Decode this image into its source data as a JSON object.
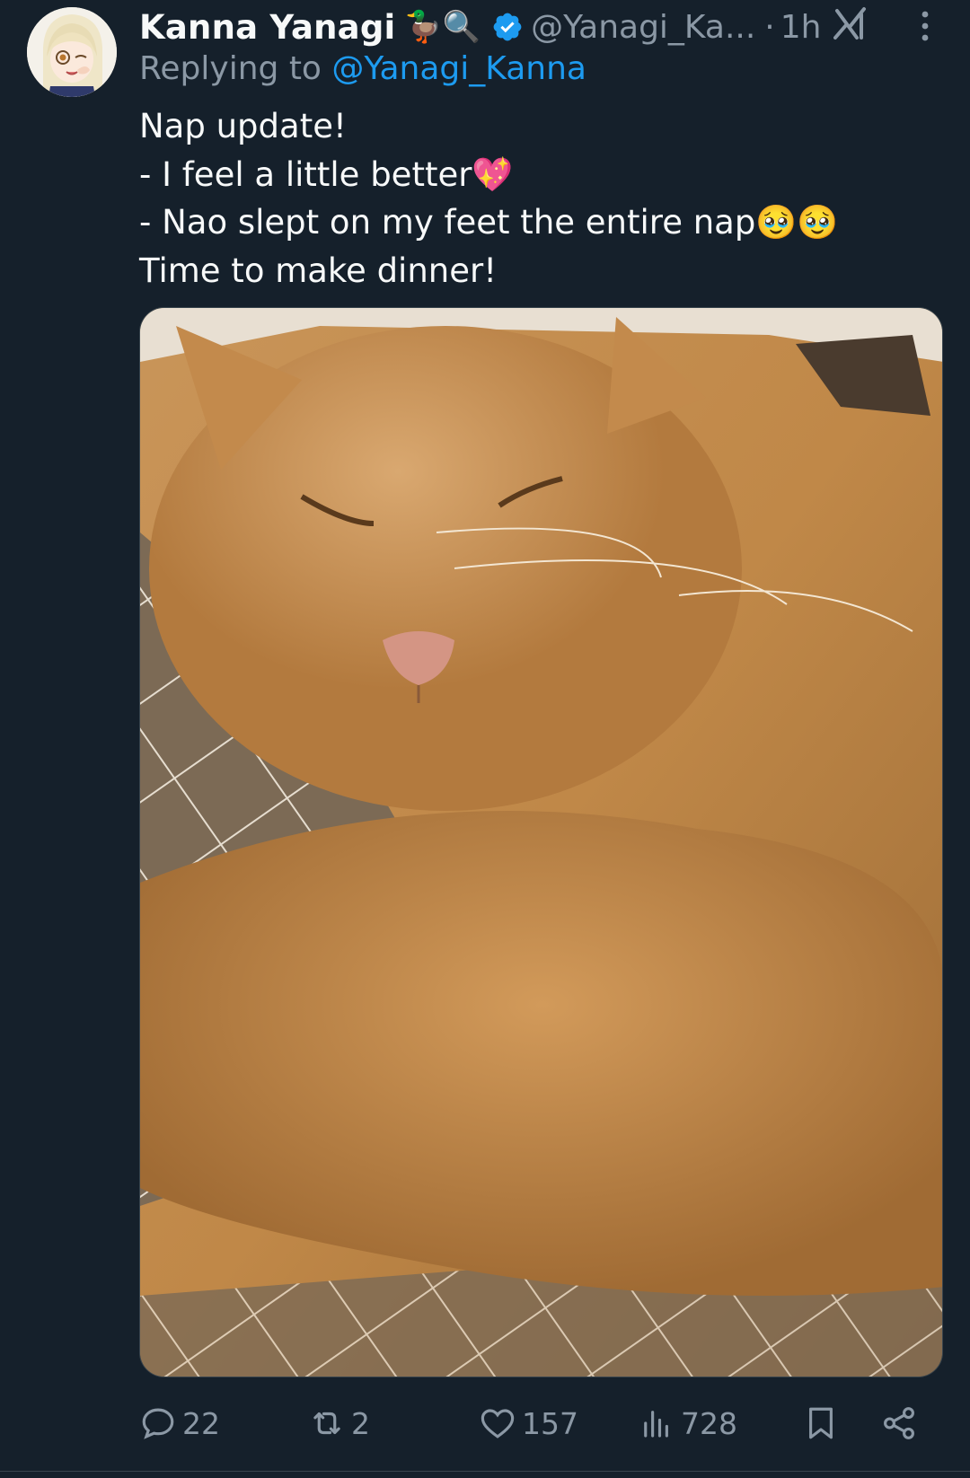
{
  "tweet": {
    "author_name": "Kanna Yanagi",
    "author_name_emoji": "🦆🔍",
    "handle": "@Yanagi_Ka...",
    "separator": "·",
    "time": "1h",
    "replying_prefix": "Replying to",
    "replying_to": "@Yanagi_Kanna",
    "body_lines": [
      "Nap update!",
      "- I feel a little better💖",
      "- Nao slept on my feet the entire nap🥹🥹",
      "Time to make dinner!"
    ]
  },
  "actions": {
    "replies": "22",
    "reposts": "2",
    "likes": "157",
    "views": "728"
  },
  "colors": {
    "background": "#15202b",
    "text": "#f7f9f9",
    "muted": "#8b98a5",
    "accent": "#1d9bf0"
  },
  "icons": [
    "verified-badge-icon",
    "grok-icon",
    "more-options-icon",
    "reply-icon",
    "repost-icon",
    "like-icon",
    "views-icon",
    "bookmark-icon",
    "share-icon"
  ]
}
